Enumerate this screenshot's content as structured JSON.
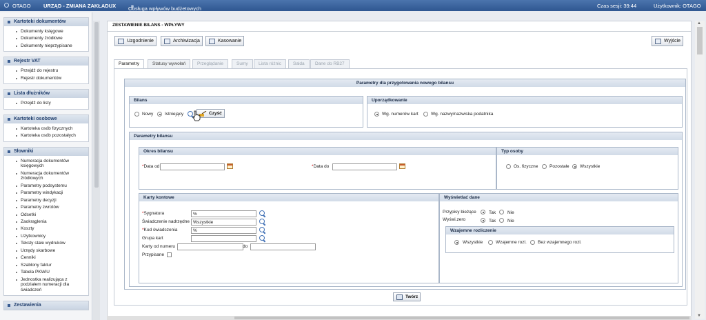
{
  "topbar": {
    "app_name": "OTAGO",
    "unit_title": "URZĄD - ZMIANA ZAKŁADUX",
    "module": "Obsługa wpływów budżetowych",
    "session_label": "Czas sesji: 39:44",
    "user_label": "Użytkownik: OTAGO"
  },
  "sidebar": {
    "sections": [
      {
        "title": "Kartoteki dokumentów",
        "items": [
          "Dokumenty księgowe",
          "Dokumenty źródłowe",
          "Dokumenty nieprzypisane"
        ]
      },
      {
        "title": "Rejestr VAT",
        "items": [
          "Przejdź do rejestru",
          "Rejestr dokumentów"
        ]
      },
      {
        "title": "Lista dłużników",
        "items": [
          "Przejdź do listy"
        ]
      },
      {
        "title": "Kartoteki osobowe",
        "items": [
          "Kartoteka osób fizycznych",
          "Kartoteka osób pozostałych"
        ]
      },
      {
        "title": "Słowniki",
        "items": [
          "Numeracja dokumentów księgowych",
          "Numeracja dokumentów źródłowych",
          "Parametry podsystemu",
          "Parametry windykacji",
          "Parametry decyzji",
          "Parametry zwrotów",
          "Odsetki",
          "Zaokrąglenia",
          "Koszty",
          "Użytkownicy",
          "Teksty stałe wydruków",
          "Urzędy skarbowe",
          "Cenniki",
          "Szablony faktur",
          "Tabela PKWiU",
          "Jednostka realizująca z podziałem numeracji dla świadczeń"
        ]
      },
      {
        "title": "Zestawienia",
        "items": []
      }
    ]
  },
  "page": {
    "title": "ZESTAWIENIE BILANS - WPŁYWY",
    "toolbar": {
      "reconcile": "Uzgodnienie",
      "archive": "Archiwizacja",
      "delete": "Kasowanie",
      "exit": "Wyjście"
    },
    "tabs": [
      {
        "label": "Parametry",
        "state": "active"
      },
      {
        "label": "Statusy wywołań",
        "state": "enabled"
      },
      {
        "label": "Przeglądanie",
        "state": "disabled"
      },
      {
        "label": "Sumy",
        "state": "disabled"
      },
      {
        "label": "Lista różnic",
        "state": "disabled"
      },
      {
        "label": "Salda",
        "state": "disabled"
      },
      {
        "label": "Dane do RB27",
        "state": "disabled"
      }
    ],
    "panel_title": "Parametry dla przygotowania nowego bilansu",
    "bilans": {
      "title": "Bilans",
      "new": "Nowy",
      "existing": "Istniejący",
      "selected": "Istniejący",
      "clear": "Czyść"
    },
    "ordering": {
      "title": "Uporządkowanie",
      "by_card": "Wg. numerów kart",
      "by_name": "Wg. nazwy/nazwiska podatnika",
      "selected": "Wg. numerów kart"
    },
    "balance_params": {
      "title": "Parametry bilansu"
    },
    "period": {
      "title": "Okres bilansu",
      "date_from_label": "Data od",
      "date_from": "",
      "date_to_label": "Data do",
      "date_to": ""
    },
    "person_type": {
      "title": "Typ osoby",
      "physical": "Os. fizyczne",
      "other": "Pozostałe",
      "all": "Wszystkie",
      "selected": "Wszystkie"
    },
    "cards": {
      "title": "Karty kontowe",
      "signature_label": "Sygnatura",
      "signature": "%",
      "parent_label": "Świadczenie nadrzędne",
      "parent": "Wszystkie",
      "code_label": "Kod świadczenia",
      "code": "%",
      "group_label": "Grupa kart",
      "group": "",
      "from_label": "Karty od numeru",
      "from": "",
      "to_label": "do",
      "to": "",
      "assigned_label": "Przypisane",
      "assigned": false
    },
    "display": {
      "title": "Wyświetlać dane",
      "current_label": "Przypisy bieżące",
      "zero_label": "Wyświ.zero",
      "yes": "Tak",
      "no": "Nie",
      "current": "Tak",
      "zero": "Tak"
    },
    "mutual": {
      "title": "Wzajemne rozliczenie",
      "all": "Wszystkie",
      "mutual": "Wzajemne rozl.",
      "none": "Bez wzajemnego rozl.",
      "selected": "Wszystkie"
    },
    "create": "Twórz"
  }
}
